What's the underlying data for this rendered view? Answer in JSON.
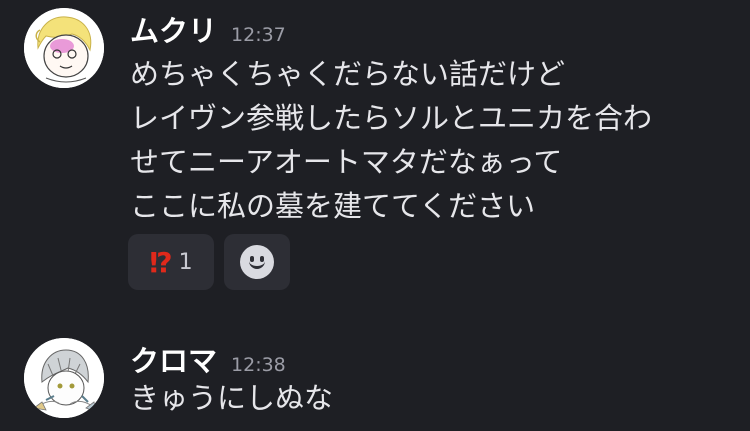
{
  "messages": [
    {
      "author": "ムクリ",
      "time": "12:37",
      "avatar_icon": "user-avatar-cartoon-blonde",
      "lines": [
        "めちゃくちゃくだらない話だけど",
        "レイヴン参戦したらソルとユニカを合わ",
        "せてニーアオートマタだなぁって",
        "ここに私の墓を建ててください"
      ],
      "reactions": [
        {
          "emoji": "⁉",
          "count": "1"
        }
      ],
      "add_reaction_icon": "smiley-add-reaction-icon"
    },
    {
      "author": "クロマ",
      "time": "12:38",
      "avatar_icon": "user-avatar-sketch-grey-hair",
      "lines": [
        "きゅうにしぬな"
      ]
    }
  ],
  "colors": {
    "background": "#1e1f24",
    "reaction_bg": "#2d2e35",
    "reaction_emoji": "#e0291b",
    "timestamp": "#9b9ca6"
  }
}
